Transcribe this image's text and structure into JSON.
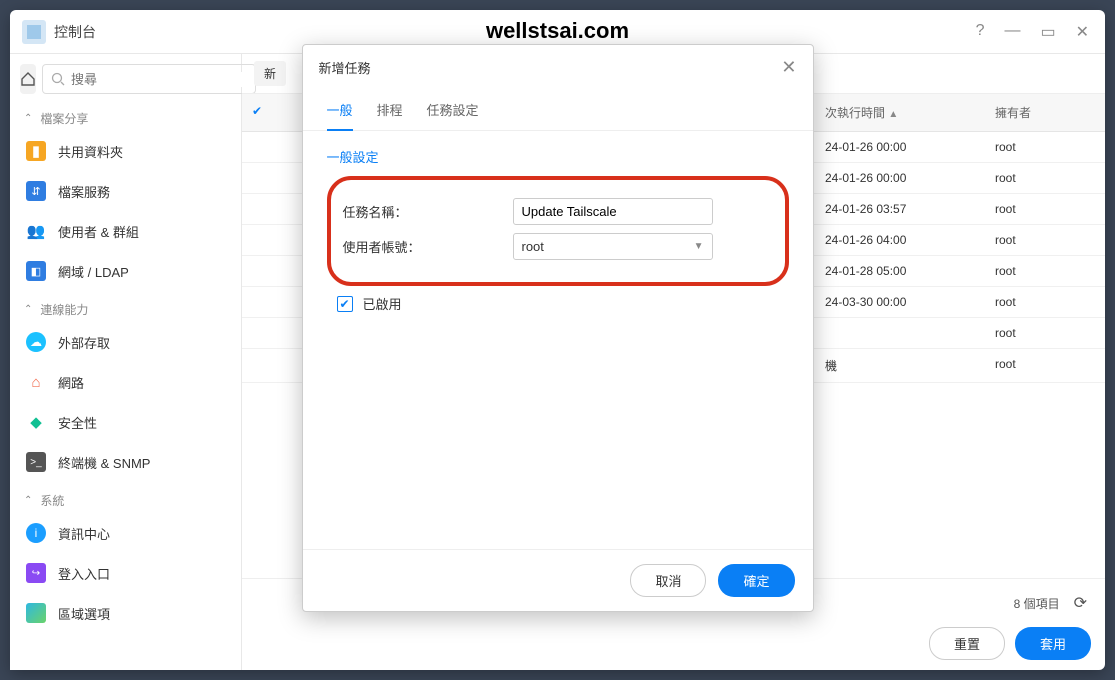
{
  "watermark": "wellstsai.com",
  "window": {
    "title": "控制台"
  },
  "search": {
    "placeholder": "搜尋"
  },
  "sidebar": {
    "groups": [
      {
        "label": "檔案分享",
        "items": [
          {
            "label": "共用資料夾",
            "icon": "folder"
          },
          {
            "label": "檔案服務",
            "icon": "file"
          },
          {
            "label": "使用者 & 群組",
            "icon": "users"
          },
          {
            "label": "網域 / LDAP",
            "icon": "ldap"
          }
        ]
      },
      {
        "label": "連線能力",
        "items": [
          {
            "label": "外部存取",
            "icon": "cloud"
          },
          {
            "label": "網路",
            "icon": "net"
          },
          {
            "label": "安全性",
            "icon": "shield"
          },
          {
            "label": "終端機 & SNMP",
            "icon": "term"
          }
        ]
      },
      {
        "label": "系統",
        "items": [
          {
            "label": "資訊中心",
            "icon": "info"
          },
          {
            "label": "登入入口",
            "icon": "login"
          },
          {
            "label": "區域選項",
            "icon": "region"
          }
        ]
      }
    ]
  },
  "toolbar": {
    "new_label": "新"
  },
  "table": {
    "col_time": "次執行時間",
    "col_owner": "擁有者",
    "rows": [
      {
        "time": "24-01-26 00:00",
        "owner": "root"
      },
      {
        "time": "24-01-26 00:00",
        "owner": "root"
      },
      {
        "time": "24-01-26 03:57",
        "owner": "root"
      },
      {
        "time": "24-01-26 04:00",
        "owner": "root"
      },
      {
        "time": "24-01-28 05:00",
        "owner": "root"
      },
      {
        "time": "24-03-30 00:00",
        "owner": "root"
      },
      {
        "time": "",
        "owner": "root"
      },
      {
        "time": "機",
        "owner": "root"
      }
    ]
  },
  "footer": {
    "count_text": "8 個項目",
    "reset": "重置",
    "apply": "套用"
  },
  "modal": {
    "title": "新增任務",
    "tabs": {
      "general": "一般",
      "schedule": "排程",
      "task_settings": "任務設定"
    },
    "section_general": "一般設定",
    "task_name_label": "任務名稱：",
    "task_name_value": "Update Tailscale",
    "user_label": "使用者帳號：",
    "user_value": "root",
    "enabled_label": "已啟用",
    "cancel": "取消",
    "ok": "確定"
  }
}
